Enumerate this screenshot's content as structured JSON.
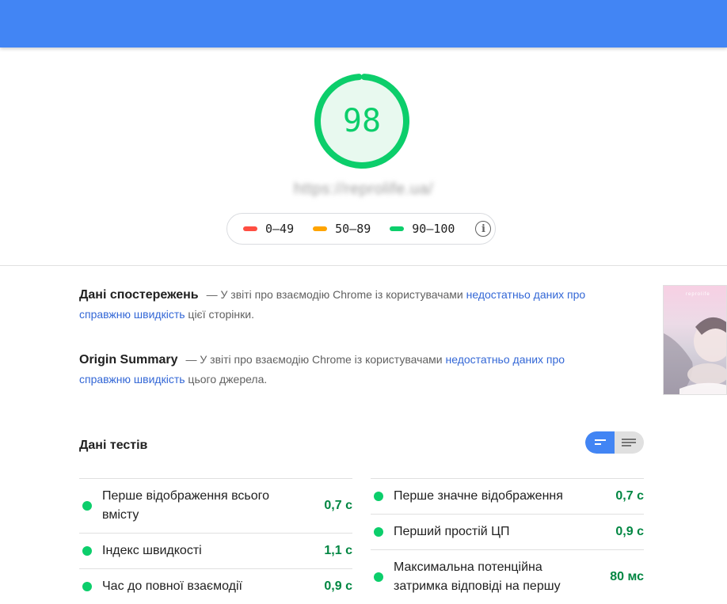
{
  "gauge": {
    "score": "98",
    "fraction": 0.98,
    "color": "#0cce6b"
  },
  "url": "https://reprolife.ua/",
  "legend": {
    "items": [
      {
        "label": "0–49",
        "color": "#ff4e42"
      },
      {
        "label": "50–89",
        "color": "#ffa400"
      },
      {
        "label": "90–100",
        "color": "#0cce6b"
      }
    ],
    "info_icon": "i"
  },
  "field_data": {
    "title": "Дані спостережень",
    "dash": "—",
    "text_before": "У звіті про взаємодію Chrome із користувачами",
    "link": "недостатньо даних про справжню швидкість",
    "text_after": "цієї сторінки."
  },
  "origin_summary": {
    "title": "Origin Summary",
    "dash": "—",
    "text_before": "У звіті про взаємодію Chrome із користувачами",
    "link": "недостатньо даних про справжню швидкість",
    "text_after": "цього джерела."
  },
  "lab_data": {
    "title": "Дані тестів",
    "metrics_left": [
      {
        "label": "Перше відображення всього вмісту",
        "value": "0,7 с"
      },
      {
        "label": "Індекс швидкості",
        "value": "1,1 с"
      },
      {
        "label": "Час до повної взаємодії",
        "value": "0,9 с"
      }
    ],
    "metrics_right": [
      {
        "label": "Перше значне відображення",
        "value": "0,7 с"
      },
      {
        "label": "Перший простій ЦП",
        "value": "0,9 с"
      },
      {
        "label": "Максимальна потенційна затримка відповіді на першу",
        "value": "80 мс"
      }
    ]
  },
  "thumbnail": {
    "logo": "reprolife"
  },
  "colors": {
    "header": "#4285f4",
    "pass": "#0cce6b",
    "link": "#3367d6"
  }
}
